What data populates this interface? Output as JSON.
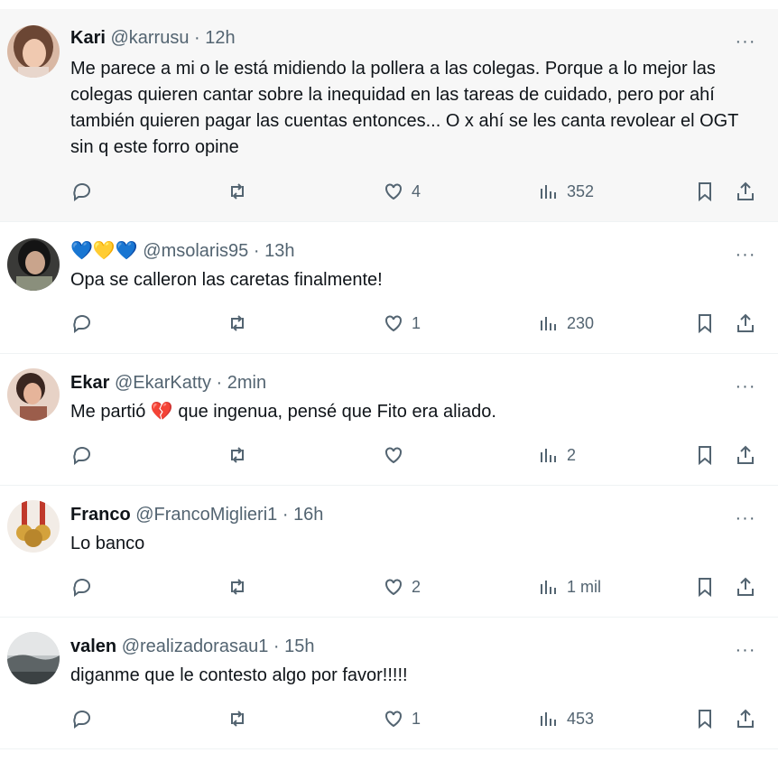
{
  "posts": [
    {
      "name": "Kari",
      "handle": "@karrusu",
      "separator": "·",
      "time": "12h",
      "text": "Me parece a mi o le está midiendo la pollera a las colegas. Porque a lo mejor las colegas quieren cantar sobre la inequidad en las tareas de cuidado, pero por ahí también quieren pagar las cuentas entonces... O x ahí se les canta revolear el OGT sin q este forro opine",
      "replies": "",
      "reposts": "",
      "likes": "4",
      "views": "352"
    },
    {
      "name": "💙💛💙",
      "handle": "@msolaris95",
      "separator": "·",
      "time": "13h",
      "text": "Opa se calleron las caretas finalmente!",
      "replies": "",
      "reposts": "",
      "likes": "1",
      "views": "230"
    },
    {
      "name": "Ekar",
      "handle": "@EkarKatty",
      "separator": "·",
      "time": "2min",
      "text": "Me partió 💔 que ingenua, pensé que Fito era aliado.",
      "replies": "",
      "reposts": "",
      "likes": "",
      "views": "2"
    },
    {
      "name": "Franco",
      "handle": "@FrancoMiglieri1",
      "separator": "·",
      "time": "16h",
      "text": "Lo banco",
      "replies": "",
      "reposts": "",
      "likes": "2",
      "views": "1 mil"
    },
    {
      "name": "valen",
      "handle": "@realizadorasau1",
      "separator": "·",
      "time": "15h",
      "text": "diganme que le contesto algo por favor!!!!!",
      "replies": "",
      "reposts": "",
      "likes": "1",
      "views": "453"
    }
  ],
  "more_label": "···",
  "icons": [
    "reply-icon",
    "repost-icon",
    "like-icon",
    "views-icon",
    "bookmark-icon",
    "share-icon"
  ],
  "colors": {
    "muted": "#536471",
    "text": "#0f1419",
    "highlight_bg": "#f7f7f7",
    "divider": "#eff3f4"
  }
}
